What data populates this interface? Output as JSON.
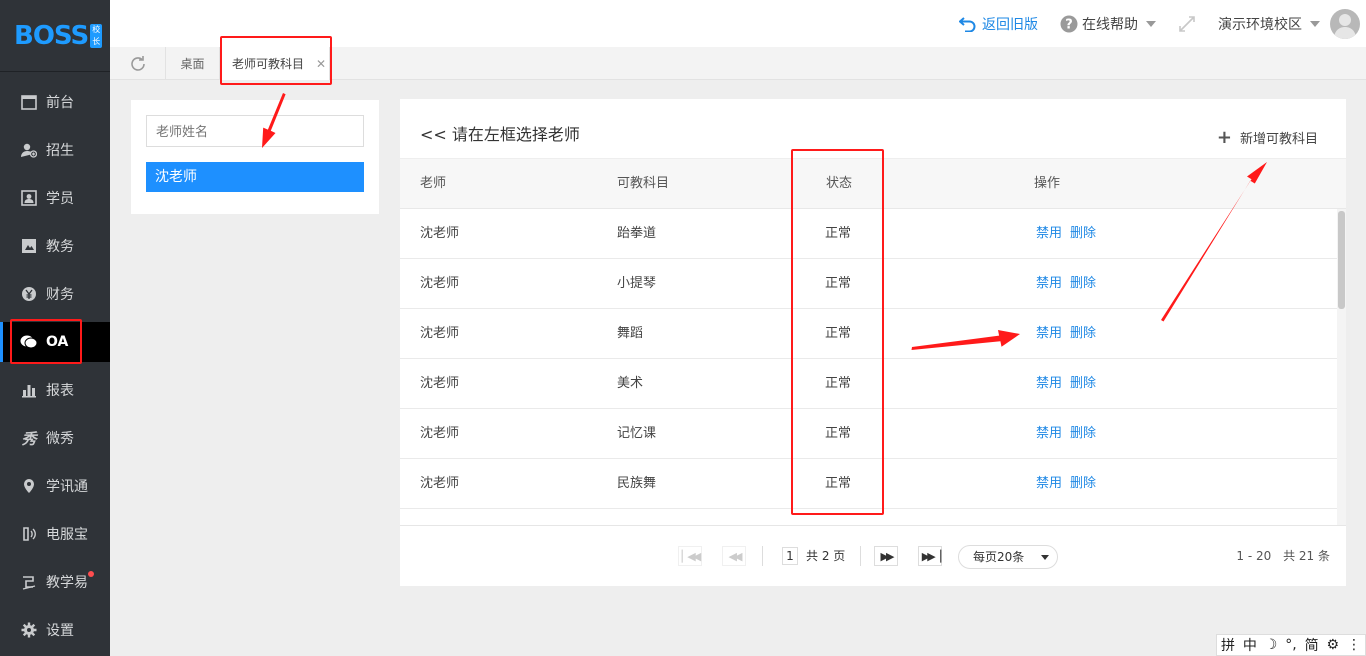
{
  "app": {
    "logo_text": "BOSS",
    "logo_badge": "校长"
  },
  "sidebar": {
    "items": [
      {
        "label": "前台",
        "icon": "calendar-icon"
      },
      {
        "label": "招生",
        "icon": "user-add-icon"
      },
      {
        "label": "学员",
        "icon": "student-card-icon"
      },
      {
        "label": "教务",
        "icon": "book-icon"
      },
      {
        "label": "财务",
        "icon": "yen-icon"
      },
      {
        "label": "OA",
        "icon": "chat-bubble-icon",
        "active": true
      },
      {
        "label": "报表",
        "icon": "bar-chart-icon"
      },
      {
        "label": "微秀",
        "icon": "xiu-icon"
      },
      {
        "label": "学讯通",
        "icon": "location-pin-icon"
      },
      {
        "label": "电服宝",
        "icon": "phone-icon"
      },
      {
        "label": "教学易",
        "icon": "teach-icon",
        "badge_dot": true
      },
      {
        "label": "设置",
        "icon": "gear-icon"
      }
    ]
  },
  "topbar": {
    "back_old": "返回旧版",
    "help": "在线帮助",
    "campus": "演示环境校区"
  },
  "tabs": [
    {
      "label": "桌面"
    },
    {
      "label": "老师可教科目",
      "active": true
    }
  ],
  "left_panel": {
    "search_placeholder": "老师姓名",
    "teachers": [
      "沈老师"
    ]
  },
  "main": {
    "title": "<< 请在左框选择老师",
    "add_button": "新增可教科目",
    "columns": [
      "老师",
      "可教科目",
      "状态",
      "操作"
    ],
    "rows": [
      {
        "teacher": "沈老师",
        "subject": "跆拳道",
        "status": "正常"
      },
      {
        "teacher": "沈老师",
        "subject": "小提琴",
        "status": "正常"
      },
      {
        "teacher": "沈老师",
        "subject": "舞蹈",
        "status": "正常"
      },
      {
        "teacher": "沈老师",
        "subject": "美术",
        "status": "正常"
      },
      {
        "teacher": "沈老师",
        "subject": "记忆课",
        "status": "正常"
      },
      {
        "teacher": "沈老师",
        "subject": "民族舞",
        "status": "正常"
      }
    ],
    "action_disable": "禁用",
    "action_delete": "删除"
  },
  "pagination": {
    "current_page": "1",
    "total_pages_text": "共 2 页",
    "page_size": "每页20条",
    "range": "1 - 20",
    "total": "共 21 条"
  },
  "ime": [
    "拼",
    "中",
    "☽",
    "°,",
    "简",
    "⚙",
    "⋮"
  ],
  "colors": {
    "accent": "#1e90ff",
    "sidebar_bg": "#2f3338",
    "annotation_red": "#ff1a1a",
    "link": "#1e88e5"
  }
}
